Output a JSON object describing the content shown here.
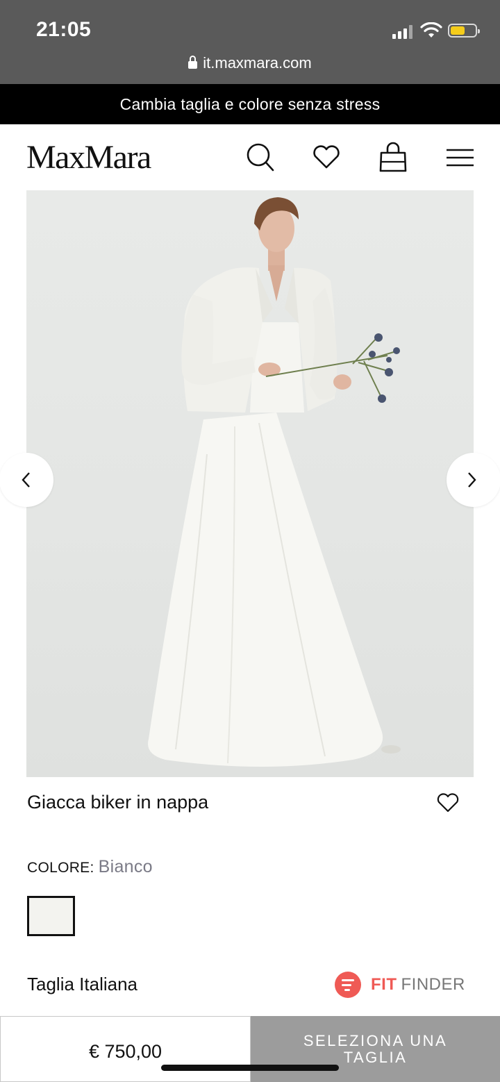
{
  "status_bar": {
    "time": "21:05",
    "battery_color": "#f5cc1a"
  },
  "browser": {
    "url": "it.maxmara.com"
  },
  "promo": {
    "text": "Cambia taglia e colore senza stress"
  },
  "header": {
    "logo": "MaxMara",
    "icons": [
      "search-icon",
      "heart-icon",
      "bag-icon",
      "menu-icon"
    ]
  },
  "gallery": {
    "prev_icon": "chevron-left-icon",
    "next_icon": "chevron-right-icon"
  },
  "product": {
    "title": "Giacca biker in nappa",
    "color_label": "COLORE:",
    "color_value": "Bianco",
    "swatch_color": "#f3f3ef",
    "size_label": "Taglia Italiana",
    "fit_finder": {
      "part1": "FIT",
      "part2": "FINDER",
      "accent": "#ef5a55"
    }
  },
  "bottom_bar": {
    "price": "€ 750,00",
    "select_line1": "SELEZIONA UNA",
    "select_line2": "TAGLIA"
  }
}
